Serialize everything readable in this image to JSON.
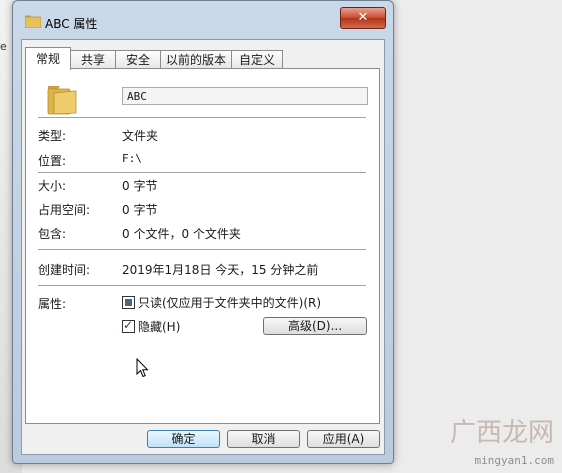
{
  "window": {
    "title": "ABC 属性",
    "close_label": "✕"
  },
  "tabs": [
    {
      "label": "常规",
      "active": true
    },
    {
      "label": "共享",
      "active": false
    },
    {
      "label": "安全",
      "active": false
    },
    {
      "label": "以前的版本",
      "active": false
    },
    {
      "label": "自定义",
      "active": false
    }
  ],
  "general": {
    "name": "ABC",
    "rows": [
      {
        "label": "类型:",
        "value": "文件夹"
      },
      {
        "label": "位置:",
        "value": "F:\\"
      },
      {
        "label": "大小:",
        "value": "0 字节"
      },
      {
        "label": "占用空间:",
        "value": "0 字节"
      },
      {
        "label": "包含:",
        "value": "0 个文件，0 个文件夹"
      }
    ],
    "created_label": "创建时间:",
    "created_value": "2019年1月18日 今天，15 分钟之前",
    "attributes_label": "属性:",
    "readonly_label": "只读(仅应用于文件夹中的文件)(R)",
    "hidden_label": "隐藏(H)",
    "advanced_label": "高级(D)..."
  },
  "buttons": {
    "ok": "确定",
    "cancel": "取消",
    "apply": "应用(A)"
  },
  "background": {
    "left_fragment": "e",
    "watermark": "广西龙网",
    "watermark_url": "mingyan1.com"
  },
  "colors": {
    "accent": "#3c7fb1",
    "close": "#c84b2e",
    "folder": "#e8c15a"
  }
}
